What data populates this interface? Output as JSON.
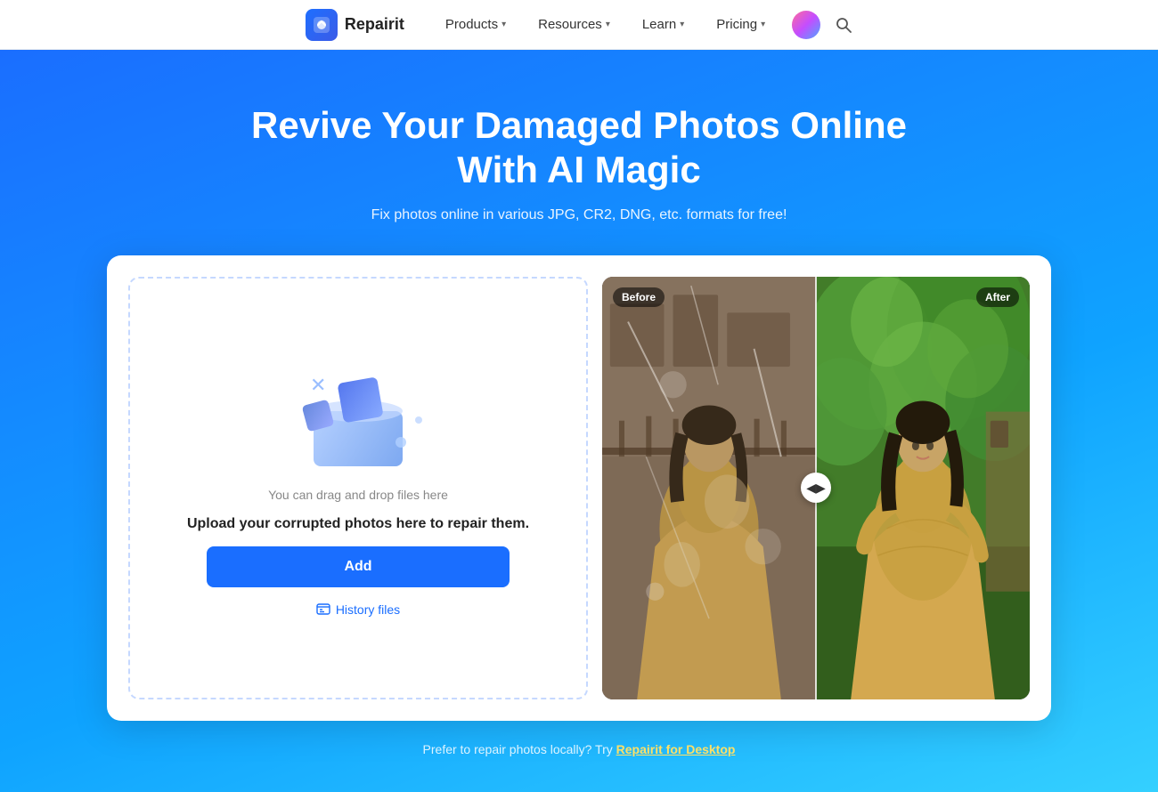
{
  "navbar": {
    "logo_text": "Repairit",
    "nav_items": [
      {
        "label": "Products",
        "has_dropdown": true
      },
      {
        "label": "Resources",
        "has_dropdown": true
      },
      {
        "label": "Learn",
        "has_dropdown": true
      },
      {
        "label": "Pricing",
        "has_dropdown": true
      }
    ]
  },
  "hero": {
    "title": "Revive Your Damaged Photos Online With AI Magic",
    "subtitle": "Fix photos online in various JPG, CR2, DNG, etc. formats for free!"
  },
  "upload": {
    "drag_text": "You can drag and drop files here",
    "main_text": "Upload your corrupted photos here to repair them.",
    "add_button_label": "Add",
    "history_label": "History files"
  },
  "before_after": {
    "before_label": "Before",
    "after_label": "After"
  },
  "footer_text": {
    "main": "Prefer to repair photos locally? Try ",
    "link": "Repairit for Desktop"
  }
}
